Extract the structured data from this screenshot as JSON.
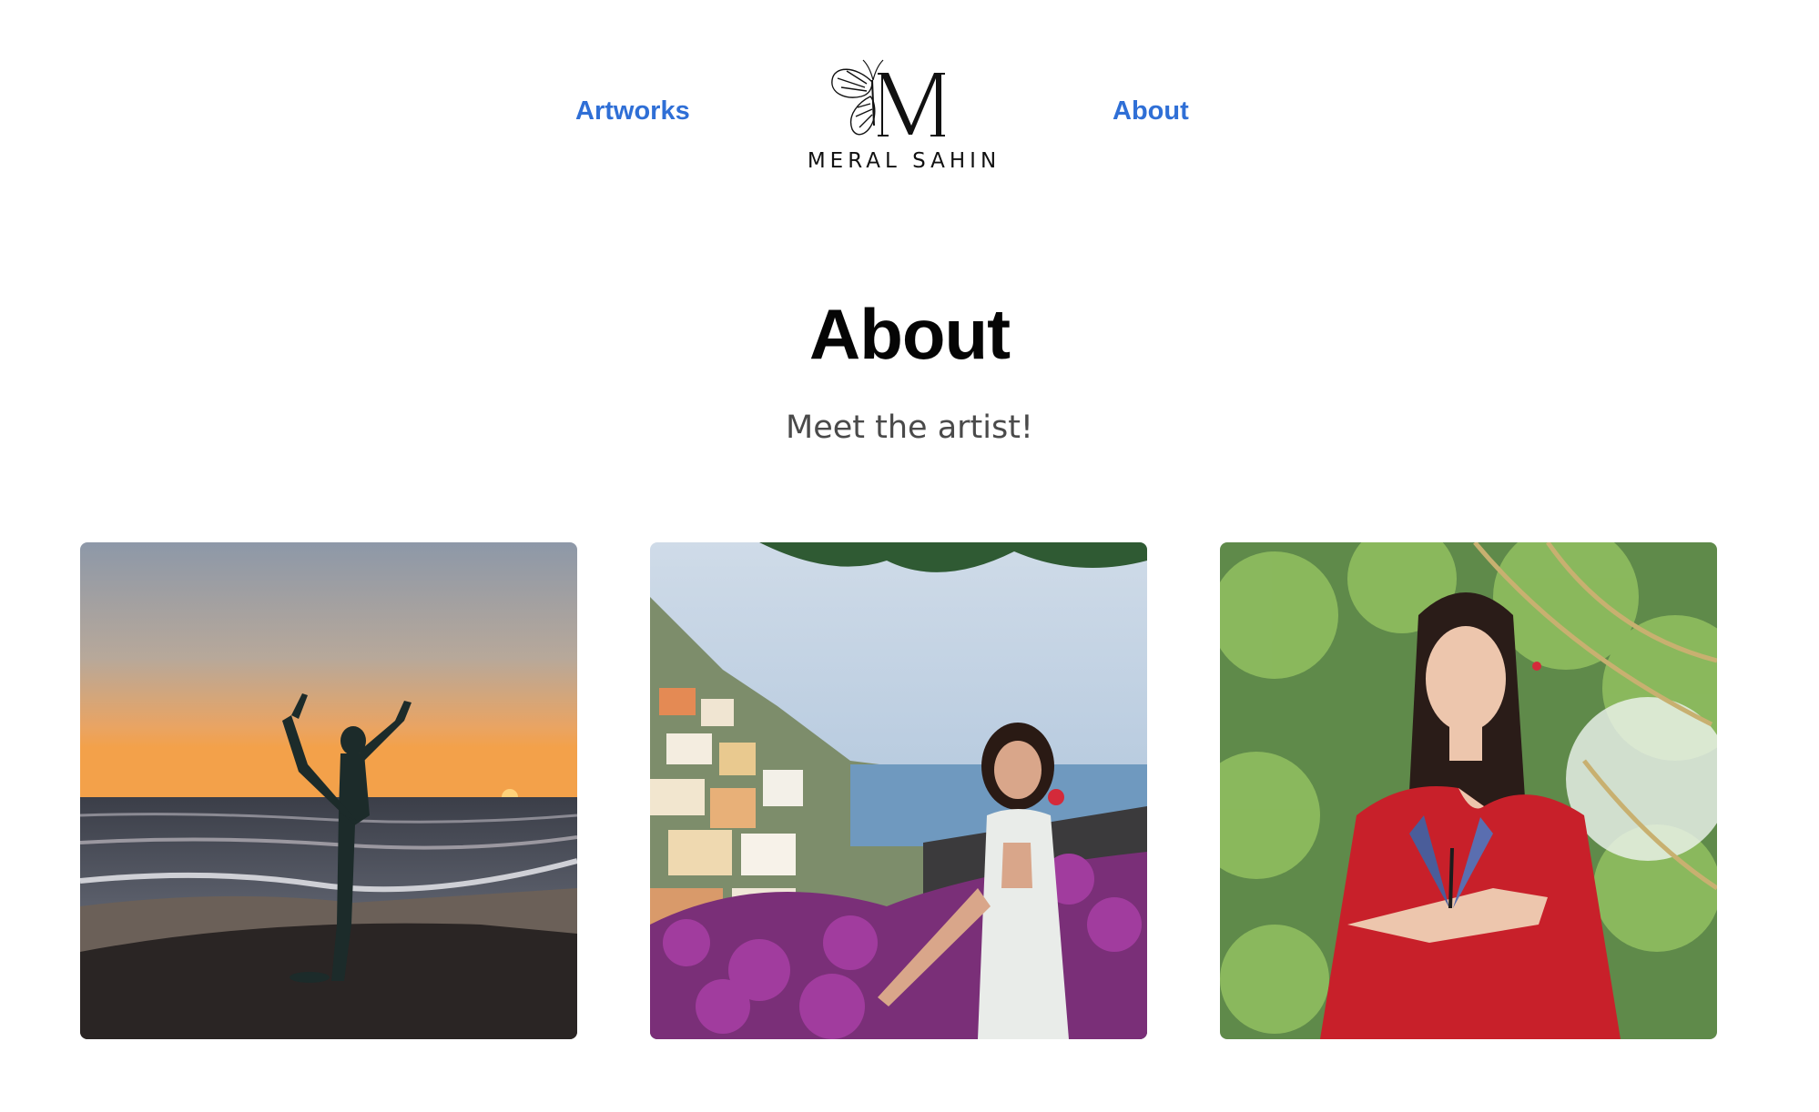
{
  "nav": {
    "left_link": "Artworks",
    "right_link": "About"
  },
  "logo": {
    "monogram": "M",
    "text": "MERAL SAHIN"
  },
  "page": {
    "title": "About",
    "subtitle": "Meet the artist!"
  },
  "photos": [
    {
      "icon": "sunset-beach-yoga-photo"
    },
    {
      "icon": "coastal-village-flowers-photo"
    },
    {
      "icon": "butterfly-garden-photo"
    }
  ],
  "colors": {
    "link": "#2f6fd6",
    "title": "#050505",
    "subtitle": "#4a4a4a",
    "background": "#ffffff"
  }
}
